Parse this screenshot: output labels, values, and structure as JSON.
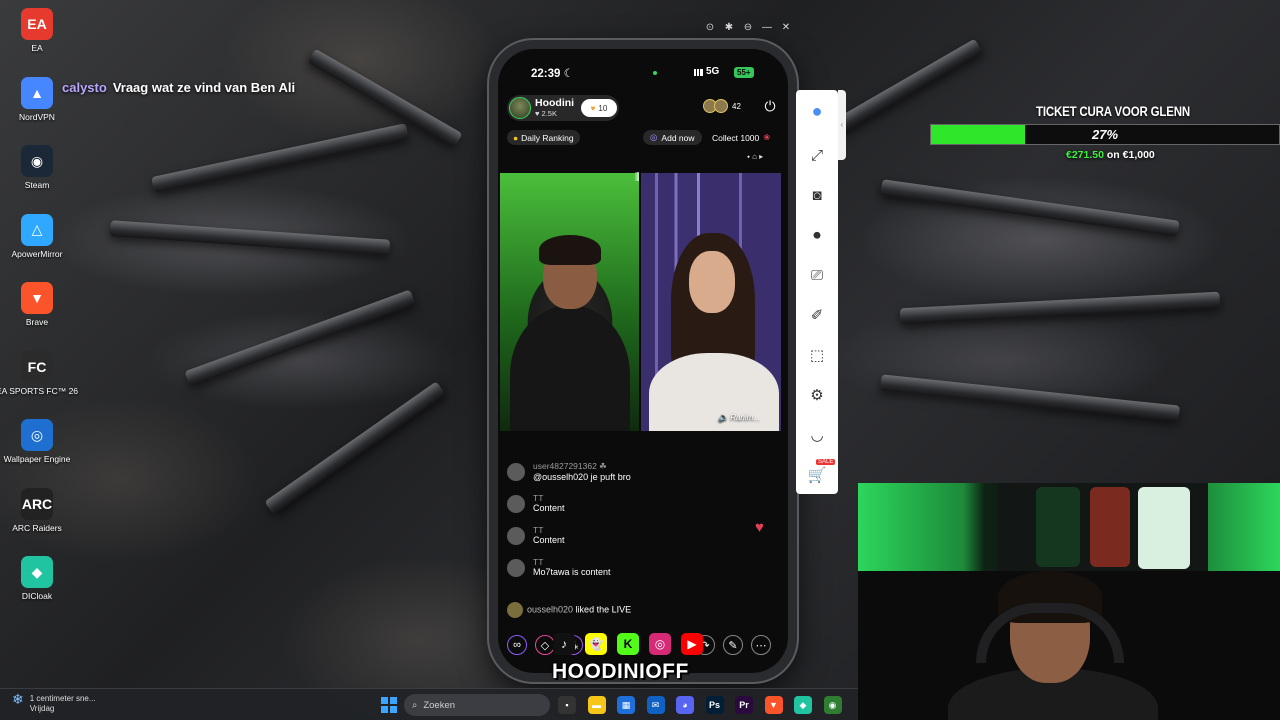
{
  "desktop": {
    "icons": [
      {
        "label": "EA",
        "glyph": "EA",
        "color": "#e63a2e",
        "icon": "ea-icon"
      },
      {
        "label": "NordVPN",
        "glyph": "▲",
        "color": "#4687ff",
        "icon": "nordvpn-icon"
      },
      {
        "label": "Steam",
        "glyph": "◉",
        "color": "#1b2838",
        "icon": "steam-icon"
      },
      {
        "label": "ApowerMirror",
        "glyph": "△",
        "color": "#2fa8ff",
        "icon": "apowermirror-icon"
      },
      {
        "label": "Brave",
        "glyph": "▼",
        "color": "#fb542b",
        "icon": "brave-icon"
      },
      {
        "label": "EA SPORTS FC™ 26",
        "glyph": "FC",
        "color": "#2b2b2b",
        "icon": "ea-sports-fc-icon"
      },
      {
        "label": "Wallpaper Engine",
        "glyph": "◎",
        "color": "#1f6fd1",
        "icon": "wallpaper-engine-icon"
      },
      {
        "label": "ARC Raiders",
        "glyph": "ARC",
        "color": "#222222",
        "icon": "arc-raiders-icon"
      },
      {
        "label": "DICloak",
        "glyph": "◆",
        "color": "#20c4a0",
        "icon": "dicloak-icon"
      }
    ]
  },
  "chat_overlay": {
    "username": "calysto",
    "message": "Vraag wat ze vind van Ben Ali"
  },
  "window_controls": [
    "⊙",
    "✱",
    "⊖",
    "—",
    "✕"
  ],
  "phone": {
    "time": "22:39",
    "network": "5G",
    "battery": "55+",
    "host": {
      "name": "Hoodini",
      "likes": "♥ 2.5K",
      "badge_count": "10"
    },
    "viewer_count": "42",
    "daily_ranking": "Daily Ranking",
    "add_now": "Add now",
    "collect": "Collect 1000",
    "guest_name": "Ranim...",
    "comments": [
      {
        "name": "user4827291362 ☘",
        "text": "@ousselh020 je puft bro"
      },
      {
        "name": "TT",
        "text": "Content"
      },
      {
        "name": "TT",
        "text": "Content"
      },
      {
        "name": "TT",
        "text": "Mo7tawa is content"
      }
    ],
    "like_event": {
      "name": "ousselh020",
      "text": "liked the LIVE"
    },
    "bottom_icons": [
      "∞",
      "◇",
      "⁂",
      "↷",
      "✎",
      "⋯"
    ]
  },
  "side_panel": {
    "icons": [
      "⤢",
      "◙",
      "⏺",
      "⎚",
      "✐",
      "⬚",
      "⚙",
      "◡",
      "🛒"
    ],
    "sale_label": "SALE"
  },
  "goal": {
    "title": "TICKET CURA VOOR GLENN",
    "percent": 27,
    "percent_label": "27%",
    "raised": "€271.50",
    "of_text": "on €1,000",
    "fill_color": "#2fe72a"
  },
  "watermark": "HOODINIOFF",
  "socials": [
    {
      "glyph": "♪",
      "color": "#111111",
      "icon": "tiktok-icon"
    },
    {
      "glyph": "👻",
      "color": "#fffc00",
      "icon": "snapchat-icon"
    },
    {
      "glyph": "K",
      "color": "#53fc18",
      "icon": "kick-icon"
    },
    {
      "glyph": "◎",
      "color": "#d62976",
      "icon": "instagram-icon"
    },
    {
      "glyph": "▶",
      "color": "#ff0000",
      "icon": "youtube-icon"
    }
  ],
  "taskbar": {
    "weather_title": "1 centimeter sne...",
    "weather_sub": "Vrijdag",
    "search_placeholder": "Zoeken",
    "apps": [
      {
        "glyph": "▪",
        "color": "#333",
        "icon": "task-view-icon"
      },
      {
        "glyph": "▬",
        "color": "#f5c518",
        "icon": "file-explorer-icon"
      },
      {
        "glyph": "▦",
        "color": "#1e6fd9",
        "icon": "calculator-icon"
      },
      {
        "glyph": "✉",
        "color": "#0f62c4",
        "icon": "outlook-icon"
      },
      {
        "glyph": "◕",
        "color": "#5865f2",
        "icon": "discord-icon"
      },
      {
        "glyph": "Ps",
        "color": "#001e36",
        "icon": "photoshop-icon"
      },
      {
        "glyph": "Pr",
        "color": "#2a0a3d",
        "icon": "premiere-icon"
      },
      {
        "glyph": "▼",
        "color": "#fb542b",
        "icon": "brave-taskbar-icon"
      },
      {
        "glyph": "◆",
        "color": "#20c4a0",
        "icon": "dicloak-taskbar-icon"
      },
      {
        "glyph": "◉",
        "color": "#2e7d32",
        "icon": "obs-icon"
      }
    ]
  }
}
